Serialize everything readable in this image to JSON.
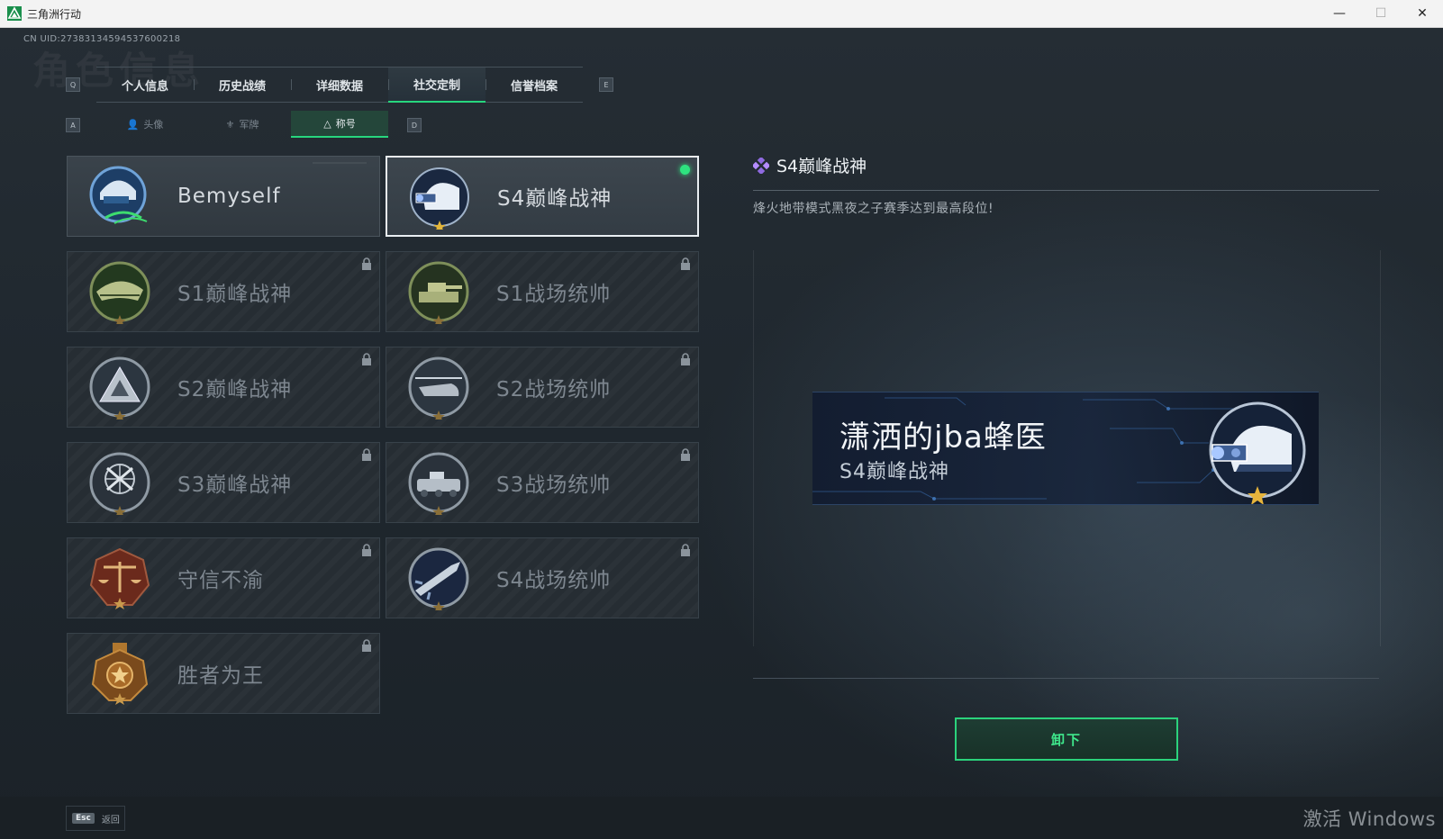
{
  "window": {
    "title": "三角洲行动",
    "minimize": "—",
    "maximize": "☐",
    "close": "✕"
  },
  "uid": "CN UID:2738313459453760021​8",
  "ghost_title": "角色信息",
  "tabs": {
    "prev_key": "Q",
    "next_key": "E",
    "items": [
      {
        "label": "个人信息"
      },
      {
        "label": "历史战绩"
      },
      {
        "label": "详细数据"
      },
      {
        "label": "社交定制"
      },
      {
        "label": "信誉档案"
      }
    ],
    "active_index": 3
  },
  "subtabs": {
    "prev_key": "A",
    "next_key": "D",
    "items": [
      {
        "label": "头像",
        "icon": "person-icon"
      },
      {
        "label": "军牌",
        "icon": "dogtag-icon"
      },
      {
        "label": "称号",
        "icon": "title-icon"
      }
    ],
    "active_index": 2
  },
  "cards": [
    {
      "label": "Bemyself",
      "state": "unlocked",
      "emblem": "helmet-signature-emblem"
    },
    {
      "label": "S4巅峰战神",
      "state": "selected",
      "emblem": "nightvision-helmet-emblem"
    },
    {
      "label": "S1巅峰战神",
      "state": "locked",
      "emblem": "crocodile-emblem"
    },
    {
      "label": "S1战场统帅",
      "state": "locked",
      "emblem": "tank-emblem"
    },
    {
      "label": "S2巅峰战神",
      "state": "locked",
      "emblem": "pyramid-emblem"
    },
    {
      "label": "S2战场统帅",
      "state": "locked",
      "emblem": "helicopter-emblem"
    },
    {
      "label": "S3巅峰战神",
      "state": "locked",
      "emblem": "globe-emblem"
    },
    {
      "label": "S3战场统帅",
      "state": "locked",
      "emblem": "armored-vehicle-emblem"
    },
    {
      "label": "守信不渝",
      "state": "locked",
      "emblem": "scales-emblem"
    },
    {
      "label": "S4战场统帅",
      "state": "locked",
      "emblem": "missile-emblem"
    },
    {
      "label": "胜者为王",
      "state": "locked",
      "emblem": "medal-emblem"
    }
  ],
  "detail": {
    "title": "S4巅峰战神",
    "description": "烽火地带模式黑夜之子赛季达到最高段位!",
    "banner_name": "潇洒的jba蜂医",
    "banner_title": "S4巅峰战神",
    "unequip_label": "卸下"
  },
  "footer": {
    "esc_key": "Esc",
    "back_label": "返回"
  },
  "watermark": "激活 Windows",
  "colors": {
    "accent": "#27d67e",
    "equipped_dot": "#2ee37f",
    "background": "#1d2329"
  }
}
